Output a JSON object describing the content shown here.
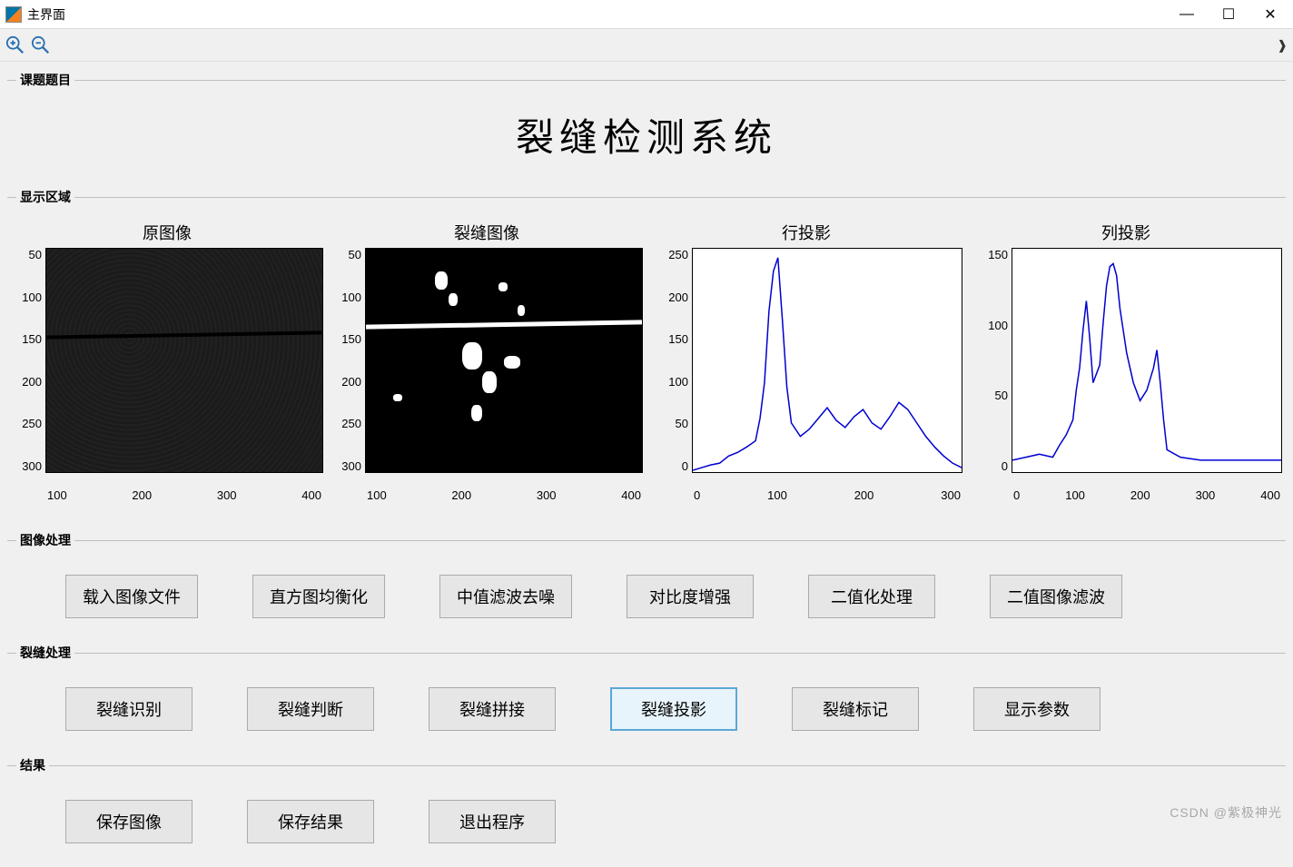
{
  "window": {
    "title": "主界面"
  },
  "toolbar": {
    "zoom_in": "zoom-in-icon",
    "zoom_out": "zoom-out-icon"
  },
  "panels": {
    "topic_legend": "课题题目",
    "display_legend": "显示区域",
    "imgproc_legend": "图像处理",
    "crackproc_legend": "裂缝处理",
    "result_legend": "结果"
  },
  "main_title": "裂缝检测系统",
  "chart_titles": {
    "orig": "原图像",
    "crack": "裂缝图像",
    "row": "行投影",
    "col": "列投影"
  },
  "buttons": {
    "imgproc": {
      "load": "载入图像文件",
      "hist": "直方图均衡化",
      "median": "中值滤波去噪",
      "contrast": "对比度增强",
      "binarize": "二值化处理",
      "binfilter": "二值图像滤波"
    },
    "crackproc": {
      "identify": "裂缝识别",
      "judge": "裂缝判断",
      "stitch": "裂缝拼接",
      "project": "裂缝投影",
      "mark": "裂缝标记",
      "params": "显示参数"
    },
    "result": {
      "save_img": "保存图像",
      "save_res": "保存结果",
      "exit": "退出程序"
    }
  },
  "watermark": "CSDN @紫极神光",
  "chart_data": [
    {
      "type": "image",
      "title": "原图像",
      "x_range": [
        0,
        400
      ],
      "y_range": [
        0,
        300
      ],
      "x_ticks": [
        100,
        200,
        300,
        400
      ],
      "y_ticks": [
        50,
        100,
        150,
        200,
        250,
        300
      ],
      "description": "dark asphalt texture with horizontal crack near y≈100"
    },
    {
      "type": "image",
      "title": "裂缝图像",
      "x_range": [
        0,
        400
      ],
      "y_range": [
        0,
        300
      ],
      "x_ticks": [
        100,
        200,
        300,
        400
      ],
      "y_ticks": [
        50,
        100,
        150,
        200,
        250,
        300
      ],
      "description": "binary image, white crack & blobs on black"
    },
    {
      "type": "line",
      "title": "行投影",
      "xlabel": "",
      "ylabel": "",
      "xlim": [
        0,
        300
      ],
      "ylim": [
        0,
        250
      ],
      "x_ticks": [
        0,
        100,
        200,
        300
      ],
      "y_ticks": [
        0,
        50,
        100,
        150,
        200,
        250
      ],
      "series": [
        {
          "name": "row",
          "values_approx": "peak≈240 at x≈95; secondary peaks 60-80 around x≈150-250"
        }
      ],
      "x": [
        0,
        10,
        20,
        30,
        40,
        50,
        60,
        70,
        75,
        80,
        85,
        90,
        95,
        100,
        105,
        110,
        120,
        130,
        140,
        150,
        160,
        170,
        180,
        190,
        200,
        210,
        220,
        230,
        240,
        250,
        260,
        270,
        280,
        290,
        300
      ],
      "y": [
        2,
        5,
        8,
        10,
        18,
        22,
        28,
        35,
        60,
        100,
        180,
        225,
        240,
        170,
        95,
        55,
        40,
        48,
        60,
        72,
        58,
        50,
        62,
        70,
        55,
        48,
        62,
        78,
        70,
        55,
        40,
        28,
        18,
        10,
        5
      ]
    },
    {
      "type": "line",
      "title": "列投影",
      "xlabel": "",
      "ylabel": "",
      "xlim": [
        0,
        400
      ],
      "ylim": [
        0,
        150
      ],
      "x_ticks": [
        0,
        100,
        200,
        300,
        400
      ],
      "y_ticks": [
        0,
        50,
        100,
        150
      ],
      "series": [
        {
          "name": "col",
          "values_approx": "three main peaks: ≈115 at x≈110, ≈140 at x≈150, ≈80 at x≈215"
        }
      ],
      "x": [
        0,
        20,
        40,
        60,
        70,
        80,
        90,
        95,
        100,
        105,
        110,
        115,
        120,
        130,
        135,
        140,
        145,
        150,
        155,
        160,
        170,
        180,
        190,
        200,
        210,
        215,
        220,
        225,
        230,
        250,
        280,
        320,
        360,
        400
      ],
      "y": [
        8,
        10,
        12,
        10,
        18,
        25,
        35,
        55,
        70,
        95,
        115,
        90,
        60,
        72,
        100,
        125,
        138,
        140,
        132,
        110,
        80,
        60,
        48,
        55,
        70,
        82,
        60,
        35,
        15,
        10,
        8,
        8,
        8,
        8
      ]
    }
  ]
}
